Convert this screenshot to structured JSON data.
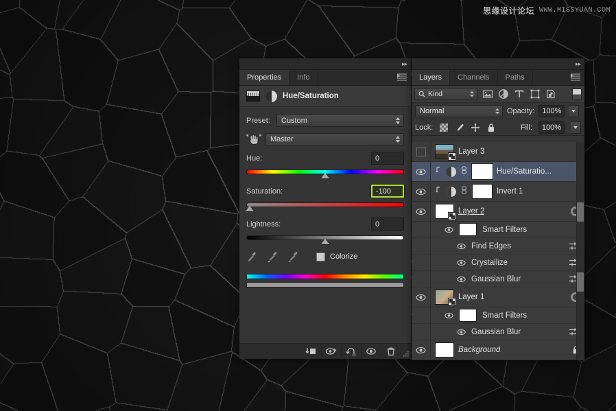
{
  "watermark": {
    "cn": "思缘设计论坛",
    "url": "WWW.MISSYUAN.COM"
  },
  "properties_panel": {
    "tabs": [
      {
        "label": "Properties",
        "active": true
      },
      {
        "label": "Info",
        "active": false
      }
    ],
    "title": "Hue/Saturation",
    "preset_label": "Preset:",
    "preset_value": "Custom",
    "channel_value": "Master",
    "sliders": [
      {
        "label": "Hue:",
        "value": "0",
        "pos_pct": 50,
        "focused": false,
        "track": "hue"
      },
      {
        "label": "Saturation:",
        "value": "-100",
        "pos_pct": 2,
        "focused": true,
        "track": "sat"
      },
      {
        "label": "Lightness:",
        "value": "0",
        "pos_pct": 50,
        "focused": false,
        "track": "light"
      }
    ],
    "colorize_label": "Colorize",
    "colorize_checked": false,
    "eyedroppers": [
      "eyedropper-icon",
      "eyedropper-add-icon",
      "eyedropper-subtract-icon"
    ],
    "footer_buttons": [
      "clip-to-layer-icon",
      "toggle-previous-state-icon",
      "reset-icon",
      "toggle-visibility-icon",
      "delete-adjustment-icon"
    ]
  },
  "layers_panel": {
    "tabs": [
      {
        "label": "Layers",
        "active": true
      },
      {
        "label": "Channels",
        "active": false
      },
      {
        "label": "Paths",
        "active": false
      }
    ],
    "kind_filter": "Kind",
    "filter_icons": [
      "pixel-filter-icon",
      "adjustment-filter-icon",
      "type-filter-icon",
      "shape-filter-icon",
      "smart-object-filter-icon"
    ],
    "blend_mode": "Normal",
    "opacity_label": "Opacity:",
    "opacity_value": "100%",
    "lock_label": "Lock:",
    "lock_icons": [
      "lock-transparency-icon",
      "lock-image-icon",
      "lock-position-icon",
      "lock-all-icon"
    ],
    "fill_label": "Fill:",
    "fill_value": "100%",
    "rows": [
      {
        "type": "layer",
        "name": "Layer 3",
        "visible": false,
        "selected": false,
        "thumb": "photo-a",
        "smart_object": true,
        "clipped": false,
        "has_mask": false,
        "italic": false,
        "underline": false,
        "locked": false,
        "smart_filter_badge": false
      },
      {
        "type": "layer",
        "name": "Hue/Saturatio...",
        "visible": true,
        "selected": true,
        "thumb": null,
        "smart_object": false,
        "clipped": true,
        "adjustment": true,
        "has_mask": true,
        "mask_active": true,
        "linked": true,
        "italic": false,
        "underline": false,
        "locked": false,
        "smart_filter_badge": false
      },
      {
        "type": "layer",
        "name": "Invert 1",
        "visible": true,
        "selected": false,
        "thumb": null,
        "smart_object": false,
        "clipped": true,
        "adjustment": true,
        "has_mask": true,
        "mask_active": false,
        "linked": true,
        "italic": false,
        "underline": false,
        "locked": false,
        "smart_filter_badge": false
      },
      {
        "type": "layer",
        "name": "Layer 2",
        "visible": true,
        "selected": false,
        "thumb": "photo-b",
        "smart_object": true,
        "clipped": false,
        "has_mask": false,
        "italic": false,
        "underline": true,
        "locked": false,
        "smart_filter_badge": true
      },
      {
        "type": "smart-filters-header",
        "name": "Smart Filters",
        "visible": true
      },
      {
        "type": "filter",
        "name": "Find Edges",
        "visible": true
      },
      {
        "type": "filter",
        "name": "Crystallize",
        "visible": true
      },
      {
        "type": "filter",
        "name": "Gaussian Blur",
        "visible": true
      },
      {
        "type": "layer",
        "name": "Layer 1",
        "visible": true,
        "selected": false,
        "thumb": "photo-c",
        "smart_object": true,
        "clipped": false,
        "has_mask": false,
        "italic": false,
        "underline": false,
        "locked": false,
        "smart_filter_badge": true
      },
      {
        "type": "smart-filters-header",
        "name": "Smart Filters",
        "visible": true
      },
      {
        "type": "filter",
        "name": "Gaussian Blur",
        "visible": true
      },
      {
        "type": "layer",
        "name": "Background",
        "visible": true,
        "selected": false,
        "thumb": "photo-b",
        "smart_object": false,
        "clipped": false,
        "has_mask": false,
        "italic": true,
        "underline": false,
        "locked": true,
        "smart_filter_badge": false
      }
    ]
  },
  "colors": {
    "panel_bg": "#353535",
    "list_bg": "#3b3b3b",
    "selection": "#4b5569",
    "focus_green": "#b6e23a",
    "text": "#e4e4e4",
    "canvas_bg": "#141414"
  }
}
